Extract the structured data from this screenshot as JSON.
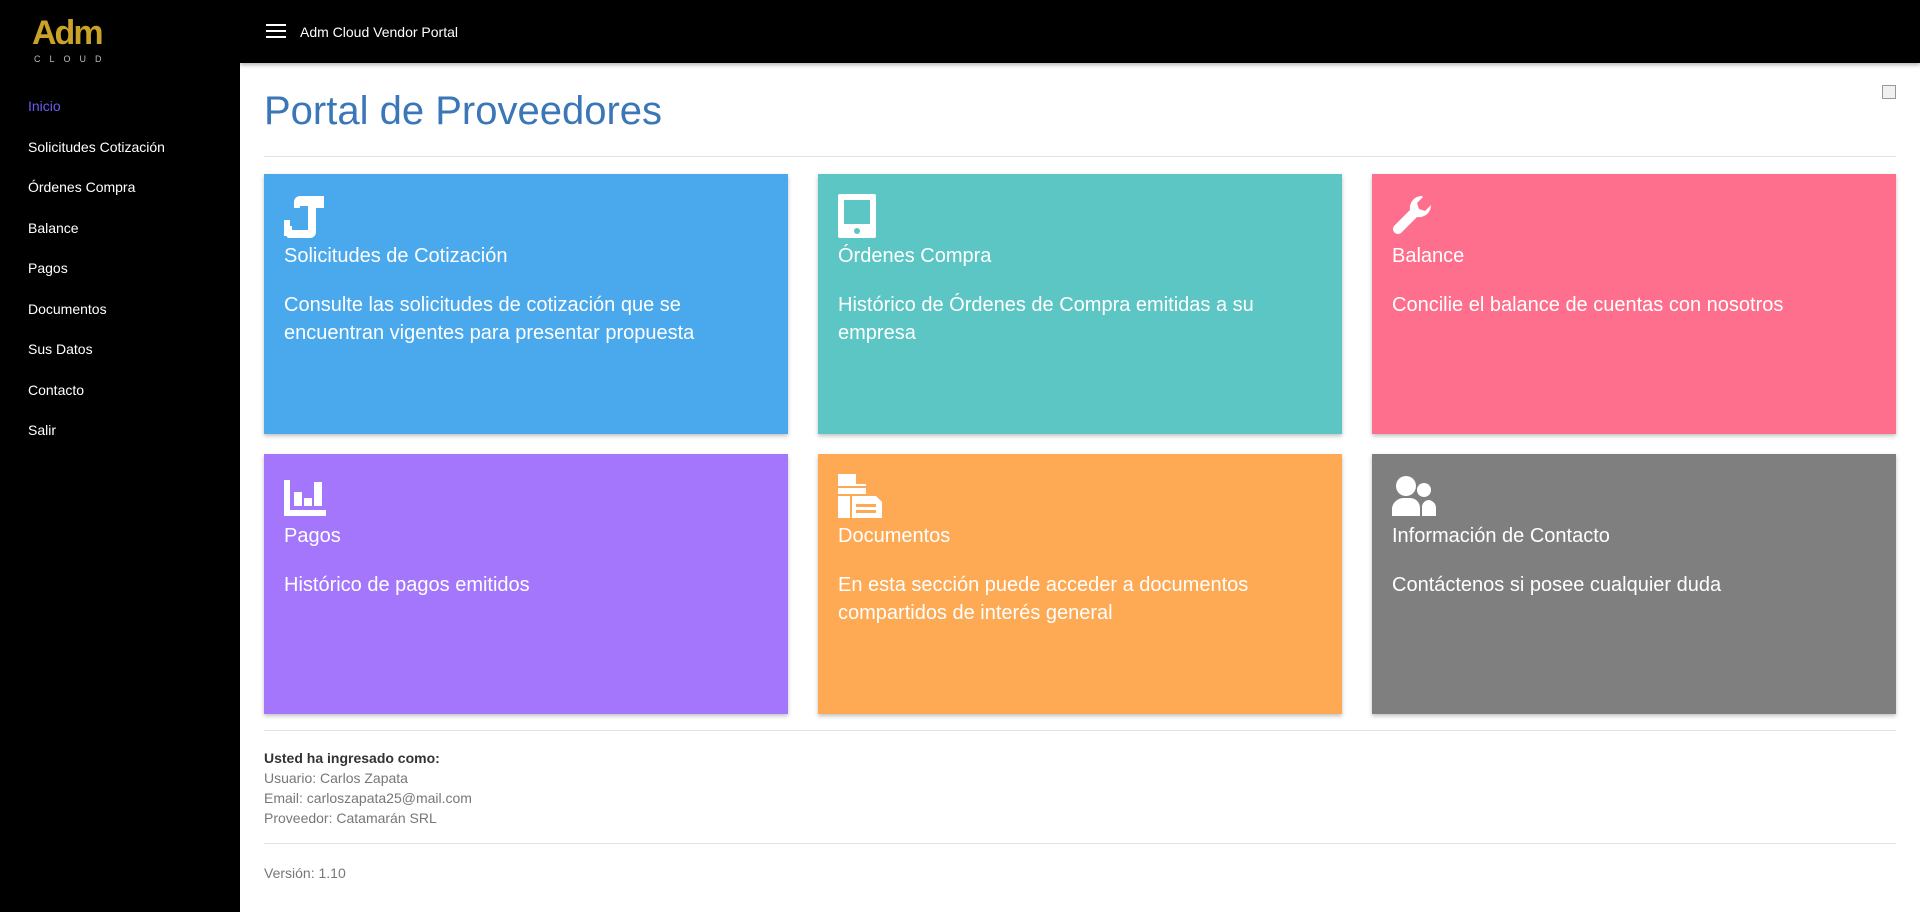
{
  "brand": {
    "logo_text": "Adm",
    "logo_sub": "CLOUD",
    "logo_color": "#c9a227"
  },
  "topbar": {
    "title": "Adm Cloud Vendor Portal",
    "menu_icon": "hamburger-menu-icon"
  },
  "sidebar": {
    "items": [
      {
        "label": "Inicio",
        "active": true
      },
      {
        "label": "Solicitudes Cotización"
      },
      {
        "label": "Órdenes Compra"
      },
      {
        "label": "Balance"
      },
      {
        "label": "Pagos"
      },
      {
        "label": "Documentos"
      },
      {
        "label": "Sus Datos"
      },
      {
        "label": "Contacto"
      },
      {
        "label": "Salir"
      }
    ],
    "active_color": "#6a5cf2"
  },
  "main": {
    "title": "Portal de Proveedores",
    "title_color": "#3a76b8",
    "cards": [
      {
        "title": "Solicitudes de Cotización",
        "desc": "Consulte las solicitudes de cotización que se encuentran vigentes para presentar propuesta",
        "color": "#4aa8ec",
        "icon": "scroll-icon"
      },
      {
        "title": "Órdenes Compra",
        "desc": "Histórico de Órdenes de Compra emitidas a su empresa",
        "color": "#5cc6c4",
        "icon": "tablet-icon"
      },
      {
        "title": "Balance",
        "desc": "Concilie el balance de cuentas con nosotros",
        "color": "#fd6f8c",
        "icon": "wrench-icon"
      },
      {
        "title": "Pagos",
        "desc": "Histórico de pagos emitidos",
        "color": "#a476fb",
        "icon": "bar-chart-icon"
      },
      {
        "title": "Documentos",
        "desc": "En esta sección puede acceder a documentos compartidos de interés general",
        "color": "#fea954",
        "icon": "documents-icon"
      },
      {
        "title": "Información de Contacto",
        "desc": "Contáctenos si posee cualquier duda",
        "color": "#7f7f7f",
        "icon": "contacts-icon"
      }
    ]
  },
  "user_info": {
    "heading": "Usted ha ingresado como:",
    "usuario": "Usuario: Carlos Zapata",
    "email": "Email: carloszapata25@mail.com",
    "proveedor": "Proveedor: Catamarán SRL"
  },
  "version": "Versión: 1.10"
}
